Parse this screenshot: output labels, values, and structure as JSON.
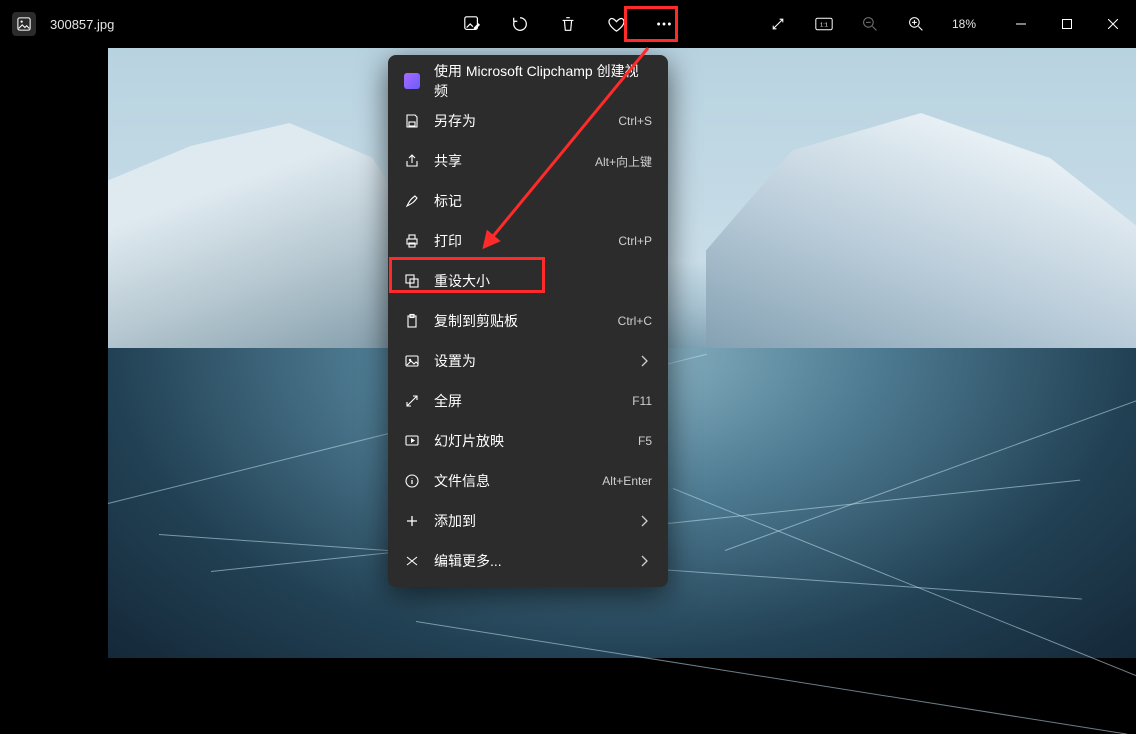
{
  "title_bar": {
    "filename": "300857.jpg",
    "zoom_label": "18%"
  },
  "menu": {
    "clipchamp": "使用 Microsoft Clipchamp 创建视频",
    "save_as": "另存为",
    "save_as_sc": "Ctrl+S",
    "share": "共享",
    "share_sc": "Alt+向上键",
    "mark": "标记",
    "print": "打印",
    "print_sc": "Ctrl+P",
    "resize": "重设大小",
    "copy": "复制到剪贴板",
    "copy_sc": "Ctrl+C",
    "setas": "设置为",
    "fullscreen": "全屏",
    "fullscreen_sc": "F11",
    "slideshow": "幻灯片放映",
    "slideshow_sc": "F5",
    "fileinfo": "文件信息",
    "fileinfo_sc": "Alt+Enter",
    "addto": "添加到",
    "editmore": "编辑更多..."
  }
}
